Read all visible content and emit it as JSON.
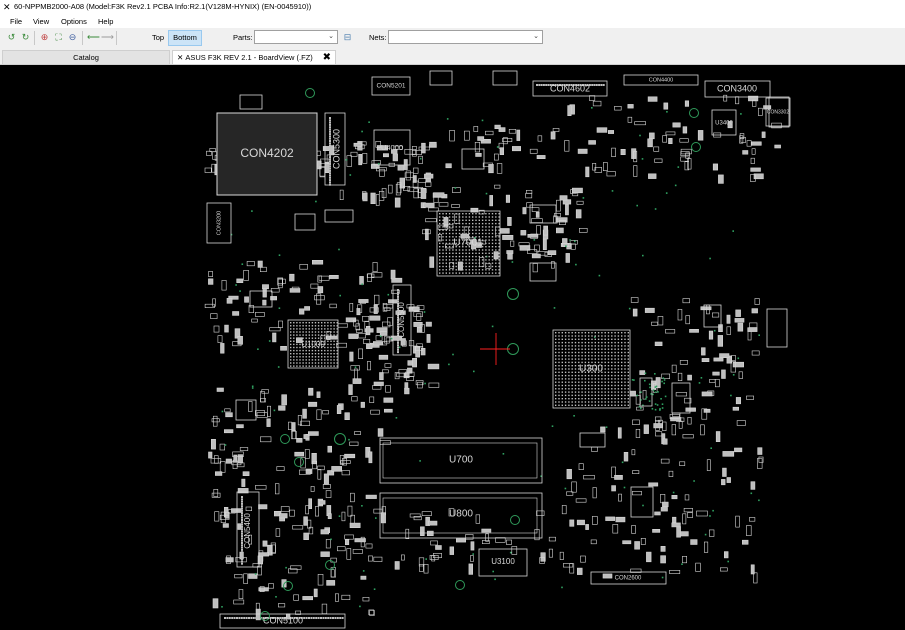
{
  "window": {
    "title": "60-NPPMB2000-A08 (Model:F3K Rev2.1 PCBA Info:R2.1(V128M-HYNIX) (EN-0045910))",
    "icon": "boardview-app-icon"
  },
  "menu": {
    "items": [
      "File",
      "View",
      "Options",
      "Help"
    ]
  },
  "toolbar": {
    "icons": [
      "rotate-left-icon",
      "rotate-right-icon",
      "zoom-in-icon",
      "zoom-fit-icon",
      "zoom-out-icon",
      "back-arrow-icon",
      "forward-arrow-icon"
    ],
    "top_label": "Top",
    "bottom_label": "Bottom",
    "parts_label": "Parts:",
    "parts_value": "",
    "nets_label": "Nets:",
    "nets_value": ""
  },
  "tabs": {
    "catalog": "Catalog",
    "board": "ASUS F3K REV 2.1 - BoardView (.FZ)"
  },
  "board": {
    "background": "#000000",
    "outline_color": "#d8d8d8",
    "pad_color": "#bfbfbf",
    "cursor_color": "#ff2020",
    "labels": {
      "con4202": "CON4202",
      "con5300": "CON5300",
      "con5201": "CON5201",
      "u4000": "U4000",
      "con4602": "CON4602",
      "con4400": "CON4400",
      "con3400": "CON3400",
      "u3400": "U3400",
      "u7001": "U7001",
      "con5500": "CON5500",
      "u1000": "U1000",
      "u300": "U300",
      "u700": "U700",
      "u800": "U800",
      "con5400": "CON5400",
      "u3100": "U3100",
      "con5100": "CON5100",
      "con3200": "CON3200",
      "con3302": "CON3302",
      "con2600": "CON2600"
    }
  }
}
